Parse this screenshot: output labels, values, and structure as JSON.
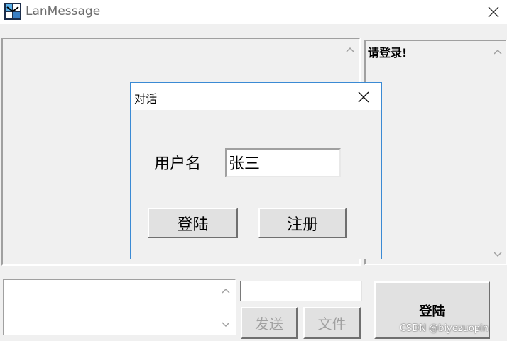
{
  "window": {
    "title": "LanMessage",
    "icon": "app-logo-icon"
  },
  "status_panel": {
    "message": "请登录!"
  },
  "bottom_bar": {
    "send_label": "发送",
    "file_label": "文件",
    "login_label": "登陆",
    "ip_input_value": ""
  },
  "dialog": {
    "title": "对话",
    "user_label": "用户名",
    "user_value": "张三",
    "login_button": "登陆",
    "register_button": "注册"
  },
  "watermark": "CSDN @biyezuopin",
  "colors": {
    "dialog_border": "#3a8ad4",
    "window_bg": "#f0f0f0"
  }
}
